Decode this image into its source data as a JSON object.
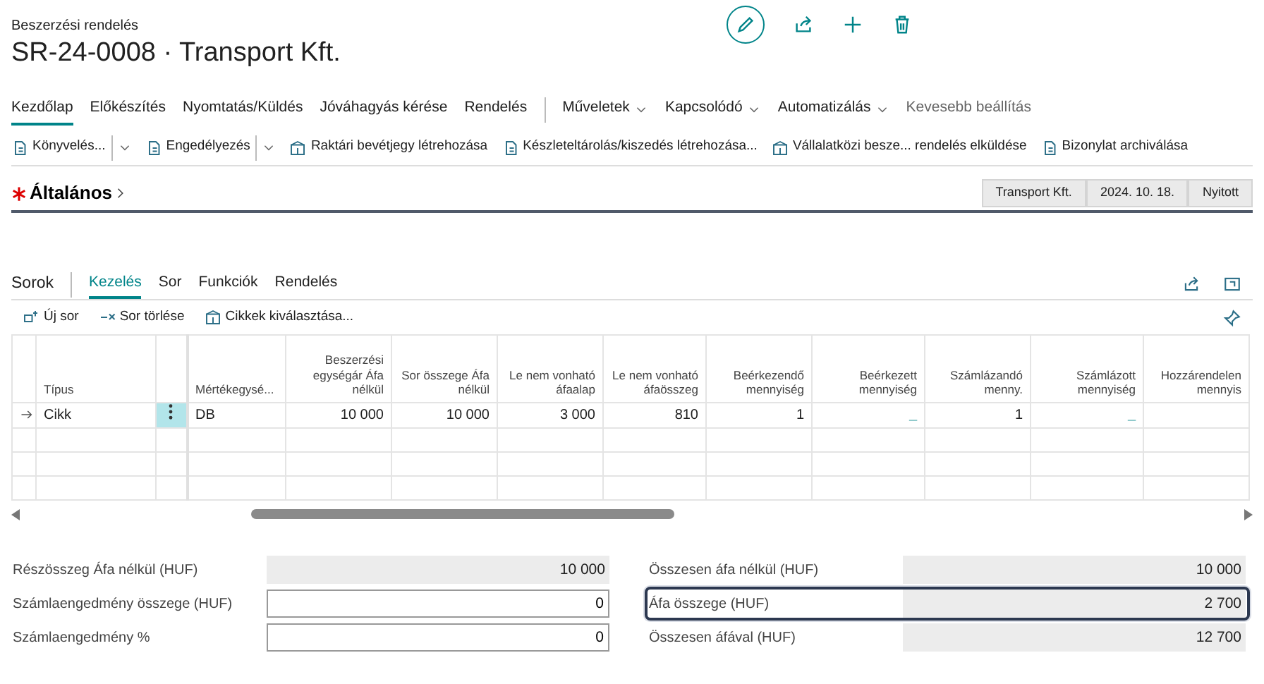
{
  "breadcrumb": "Beszerzési rendelés",
  "title": "SR-24-0008 · Transport Kft.",
  "menu": [
    {
      "label": "Kezdőlap",
      "kind": "tab",
      "selected": true
    },
    {
      "label": "Előkészítés",
      "kind": "tab",
      "selected": false
    },
    {
      "label": "Nyomtatás/Küldés",
      "kind": "tab",
      "selected": false
    },
    {
      "label": "Jóváhagyás kérése",
      "kind": "tab",
      "selected": false
    },
    {
      "label": "Rendelés",
      "kind": "tab",
      "selected": false
    },
    {
      "label": "Műveletek",
      "kind": "dropdown",
      "selected": false
    },
    {
      "label": "Kapcsolódó",
      "kind": "dropdown",
      "selected": false
    },
    {
      "label": "Automatizálás",
      "kind": "dropdown",
      "selected": false
    },
    {
      "label": "Kevesebb beállítás",
      "kind": "link",
      "selected": false
    }
  ],
  "actions": [
    {
      "label": "Könyvelés...",
      "split": true
    },
    {
      "label": "Engedélyezés",
      "split": true
    },
    {
      "label": "Raktári bevétjegy létrehozása",
      "split": false
    },
    {
      "label": "Készleteltárolás/kiszedés létrehozása...",
      "split": false
    },
    {
      "label": "Vállalatközi besze... rendelés elküldése",
      "split": false
    },
    {
      "label": "Bizonylat archiválása",
      "split": false
    }
  ],
  "general": {
    "title": "Általános",
    "required": true,
    "tags": [
      "Transport Kft.",
      "2024. 10. 18.",
      "Nyitott"
    ]
  },
  "lines": {
    "title": "Sorok",
    "tabs": [
      {
        "label": "Kezelés",
        "selected": true
      },
      {
        "label": "Sor",
        "selected": false
      },
      {
        "label": "Funkciók",
        "selected": false
      },
      {
        "label": "Rendelés",
        "selected": false
      }
    ],
    "actions": [
      "Új sor",
      "Sor törlése",
      "Cikkek kiválasztása..."
    ],
    "columns": [
      "Típus",
      "Mértékegysé...",
      "Beszerzési egységár Áfa nélkül",
      "Sor összege Áfa nélkül",
      "Le nem vonható áfaalap",
      "Le nem vonható áfaösszeg",
      "Beérkezendő mennyiség",
      "Beérkezett mennyiség",
      "Számlázandó menny.",
      "Számlázott mennyiség",
      "Hozzárendelen mennyis"
    ],
    "rows": [
      {
        "selected": true,
        "cells": [
          "Cikk",
          "DB",
          "10 000",
          "10 000",
          "3 000",
          "810",
          "1",
          "_",
          "1",
          "_"
        ]
      }
    ]
  },
  "totals": {
    "left": [
      {
        "label": "Részösszeg Áfa nélkül (HUF)",
        "value": "10 000",
        "editable": false,
        "focused": false
      },
      {
        "label": "Számlaengedmény összege (HUF)",
        "value": "0",
        "editable": true,
        "focused": false
      },
      {
        "label": "Számlaengedmény %",
        "value": "0",
        "editable": true,
        "focused": false
      }
    ],
    "right": [
      {
        "label": "Összesen áfa nélkül (HUF)",
        "value": "10 000",
        "editable": false,
        "focused": false
      },
      {
        "label": "Áfa összege (HUF)",
        "value": "2 700",
        "editable": false,
        "focused": true
      },
      {
        "label": "Összesen áfával (HUF)",
        "value": "12 700",
        "editable": false,
        "focused": false
      }
    ]
  }
}
